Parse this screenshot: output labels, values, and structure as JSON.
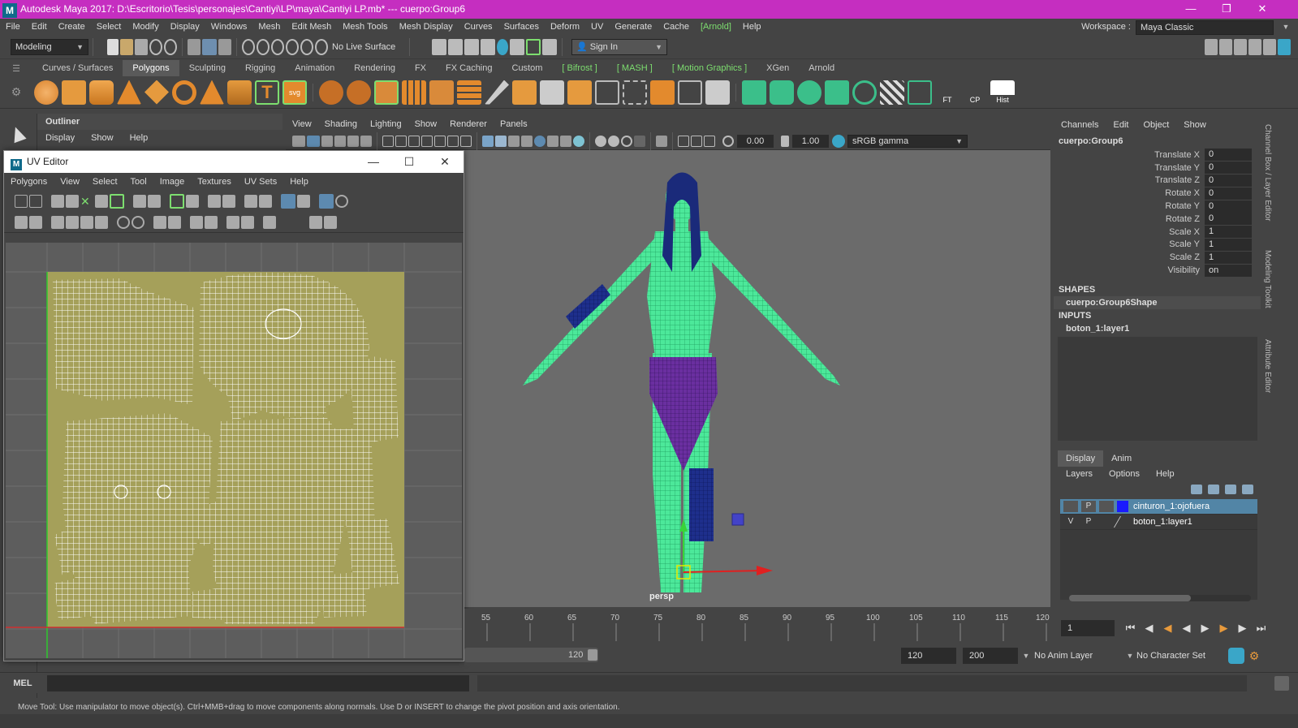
{
  "window": {
    "title": "Autodesk Maya 2017: D:\\Escritorio\\Tesis\\personajes\\Cantiyi\\LP\\maya\\Cantiyi LP.mb*  ---   cuerpo:Group6"
  },
  "menubar": [
    "File",
    "Edit",
    "Create",
    "Select",
    "Modify",
    "Display",
    "Windows",
    "Mesh",
    "Edit Mesh",
    "Mesh Tools",
    "Mesh Display",
    "Curves",
    "Surfaces",
    "Deform",
    "UV",
    "Generate",
    "Cache",
    "[Arnold]",
    "Help"
  ],
  "workspace": {
    "label": "Workspace :",
    "value": "Maya Classic"
  },
  "statusline": {
    "mode": "Modeling",
    "live_surface": "No Live Surface",
    "sign_in": "Sign In"
  },
  "shelf": {
    "tabs": [
      "Curves / Surfaces",
      "Polygons",
      "Sculpting",
      "Rigging",
      "Animation",
      "Rendering",
      "FX",
      "FX Caching",
      "Custom",
      "[ Bifrost ]",
      "[ MASH ]",
      "[ Motion Graphics ]",
      "XGen",
      "Arnold"
    ],
    "active": "Polygons",
    "badges": [
      "FT",
      "CP",
      "Hist"
    ]
  },
  "outliner": {
    "title": "Outliner",
    "menu": [
      "Display",
      "Show",
      "Help"
    ]
  },
  "viewport": {
    "menu": [
      "View",
      "Shading",
      "Lighting",
      "Show",
      "Renderer",
      "Panels"
    ],
    "exposure": "0.00",
    "gamma": "1.00",
    "colorspace": "sRGB gamma",
    "camera": "persp"
  },
  "uv_editor": {
    "title": "UV Editor",
    "menu": [
      "Polygons",
      "View",
      "Select",
      "Tool",
      "Image",
      "Textures",
      "UV Sets",
      "Help"
    ]
  },
  "channel_box": {
    "menu": [
      "Channels",
      "Edit",
      "Object",
      "Show"
    ],
    "object": "cuerpo:Group6",
    "attributes": [
      {
        "name": "Translate X",
        "value": "0"
      },
      {
        "name": "Translate Y",
        "value": "0"
      },
      {
        "name": "Translate Z",
        "value": "0"
      },
      {
        "name": "Rotate X",
        "value": "0"
      },
      {
        "name": "Rotate Y",
        "value": "0"
      },
      {
        "name": "Rotate Z",
        "value": "0"
      },
      {
        "name": "Scale X",
        "value": "1"
      },
      {
        "name": "Scale Y",
        "value": "1"
      },
      {
        "name": "Scale Z",
        "value": "1"
      },
      {
        "name": "Visibility",
        "value": "on"
      }
    ],
    "shapes_header": "SHAPES",
    "shape": "cuerpo:Group6Shape",
    "inputs_header": "INPUTS",
    "input": "boton_1:layer1"
  },
  "side_tabs": [
    "Channel Box / Layer Editor",
    "Modeling Toolkit",
    "Attribute Editor"
  ],
  "layer_editor": {
    "tabs": [
      "Display",
      "Anim"
    ],
    "menu": [
      "Layers",
      "Options",
      "Help"
    ],
    "layers": [
      {
        "v": "",
        "p": "P",
        "name": "cinturon_1:ojofuera",
        "color": "#1a1aff"
      },
      {
        "v": "V",
        "p": "P",
        "name": "boton_1:layer1",
        "color": ""
      }
    ]
  },
  "timeslider": {
    "ticks": [
      "55",
      "60",
      "65",
      "70",
      "75",
      "80",
      "85",
      "90",
      "95",
      "100",
      "105",
      "110",
      "115",
      "120"
    ],
    "current_frame": "1"
  },
  "range": {
    "end_a": "120",
    "end_b": "120",
    "anim_end": "200",
    "anim_layer": "No Anim Layer",
    "char_set": "No Character Set"
  },
  "command_line": {
    "label": "MEL"
  },
  "help_line": "Move Tool: Use manipulator to move object(s). Ctrl+MMB+drag to move components along normals. Use D or INSERT to change the pivot position and axis orientation."
}
